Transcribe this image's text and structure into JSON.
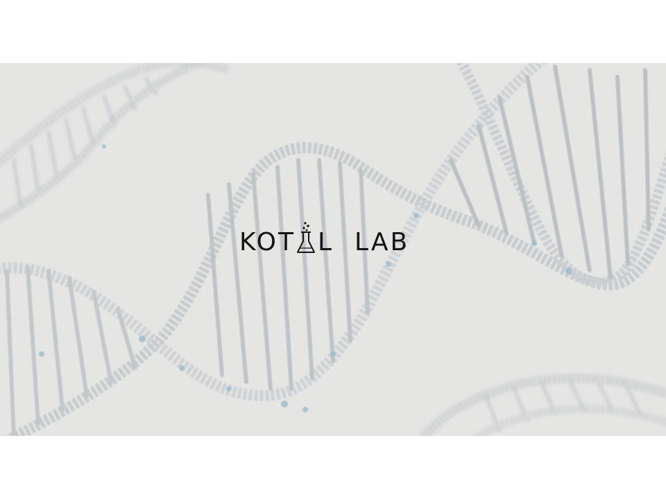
{
  "logo": {
    "part1": "KOT",
    "part2": "L",
    "part3": "LAB",
    "icon": "flask-icon"
  },
  "colors": {
    "banner_background": "#e5e5e4",
    "logo_text": "#141414",
    "helix_strand": "#c8cccf",
    "helix_accent": "#8fb3c4"
  }
}
